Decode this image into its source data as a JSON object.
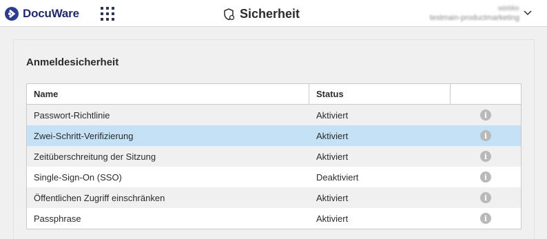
{
  "app": {
    "name": "DocuWare",
    "page_title": "Sicherheit"
  },
  "user": {
    "name": "wiebke",
    "org": "testmain-productmarketing"
  },
  "section": {
    "title": "Anmeldesicherheit"
  },
  "table": {
    "headers": [
      "Name",
      "Status",
      ""
    ],
    "rows": [
      {
        "name": "Passwort-Richtlinie",
        "status": "Aktiviert"
      },
      {
        "name": "Zwei-Schritt-Verifizierung",
        "status": "Aktiviert",
        "selected": true
      },
      {
        "name": "Zeitüberschreitung der Sitzung",
        "status": "Aktiviert"
      },
      {
        "name": "Single-Sign-On (SSO)",
        "status": "Deaktiviert"
      },
      {
        "name": "Öffentlichen Zugriff einschränken",
        "status": "Aktiviert"
      },
      {
        "name": "Passphrase",
        "status": "Aktiviert"
      }
    ]
  },
  "icons": {
    "logo": "docuware-logo-icon",
    "apps": "apps-grid-icon",
    "title": "security-shield-icon",
    "user_menu": "chevron-down-icon",
    "row_info": "info-icon"
  },
  "colors": {
    "brand": "#2c3c8e",
    "selected_row": "#c4e1f6",
    "info_icon": "#b9b9b9"
  }
}
